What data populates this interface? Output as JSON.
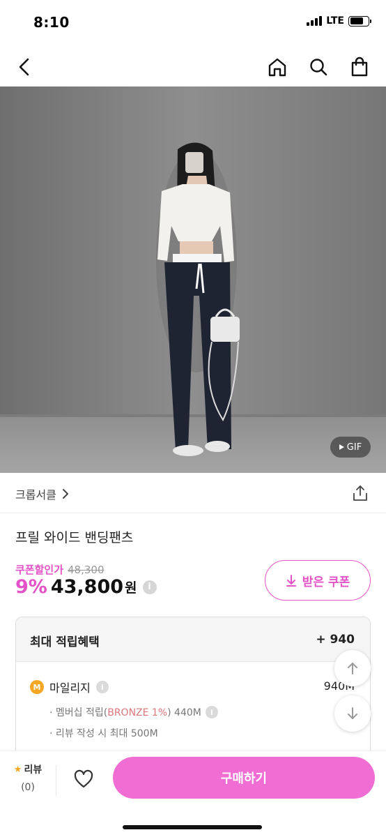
{
  "status_bar": {
    "time": "8:10",
    "network": "LTE"
  },
  "nav": {
    "back_icon": "chevron-left-icon",
    "home_icon": "home-icon",
    "search_icon": "search-icon",
    "bag_icon": "shopping-bag-icon"
  },
  "hero": {
    "gif_label": "GIF"
  },
  "brand": {
    "name": "크롭서클"
  },
  "product": {
    "title": "프릴 와이드 밴딩팬츠",
    "coupon_label": "쿠폰할인가",
    "original_price": "48,300",
    "discount": "9%",
    "price": "43,800",
    "currency": "원",
    "coupon_button": "받은 쿠폰"
  },
  "benefits": {
    "title": "최대 적립혜택",
    "total": "+ 940",
    "mileage_label": "마일리지",
    "mileage_badge": "M",
    "mileage_amount": "940M",
    "line1_prefix": "· 멤버십 적립(",
    "line1_grade": "BRONZE 1%",
    "line1_suffix": ") 440M",
    "line2": "· 리뷰 작성 시 최대 500M"
  },
  "bottom_bar": {
    "review_label": "리뷰",
    "review_count": "(0)",
    "buy_label": "구매하기"
  },
  "colors": {
    "accent": "#e352c6",
    "buy_button": "#f06ed3",
    "mileage_badge": "#f5a623"
  }
}
